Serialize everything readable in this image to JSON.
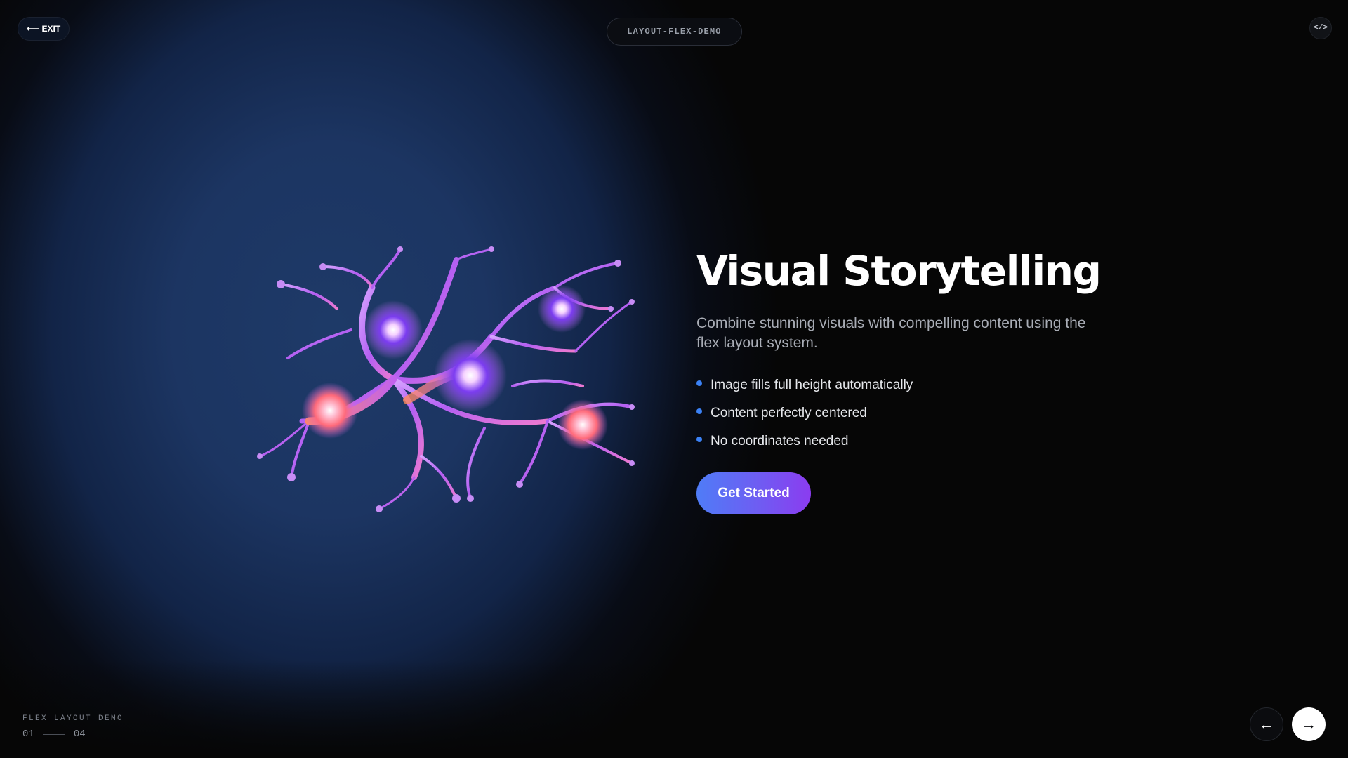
{
  "header": {
    "exit_label": "EXIT",
    "tag_label": "LAYOUT-FLEX-DEMO",
    "code_icon": "code-icon"
  },
  "slide": {
    "title": "Visual Storytelling",
    "description": "Combine stunning visuals with compelling content using the flex layout system.",
    "bullets": [
      "Image fills full height automatically",
      "Content perfectly centered",
      "No coordinates needed"
    ],
    "cta_label": "Get Started"
  },
  "footer": {
    "label": "FLEX LAYOUT DEMO",
    "current_page": "01",
    "total_pages": "04"
  },
  "colors": {
    "accent": "#3b82f6",
    "cta_start": "#4f7cf7",
    "cta_end": "#8b3cf0",
    "background": "#060606",
    "panel": "#1c3562"
  }
}
